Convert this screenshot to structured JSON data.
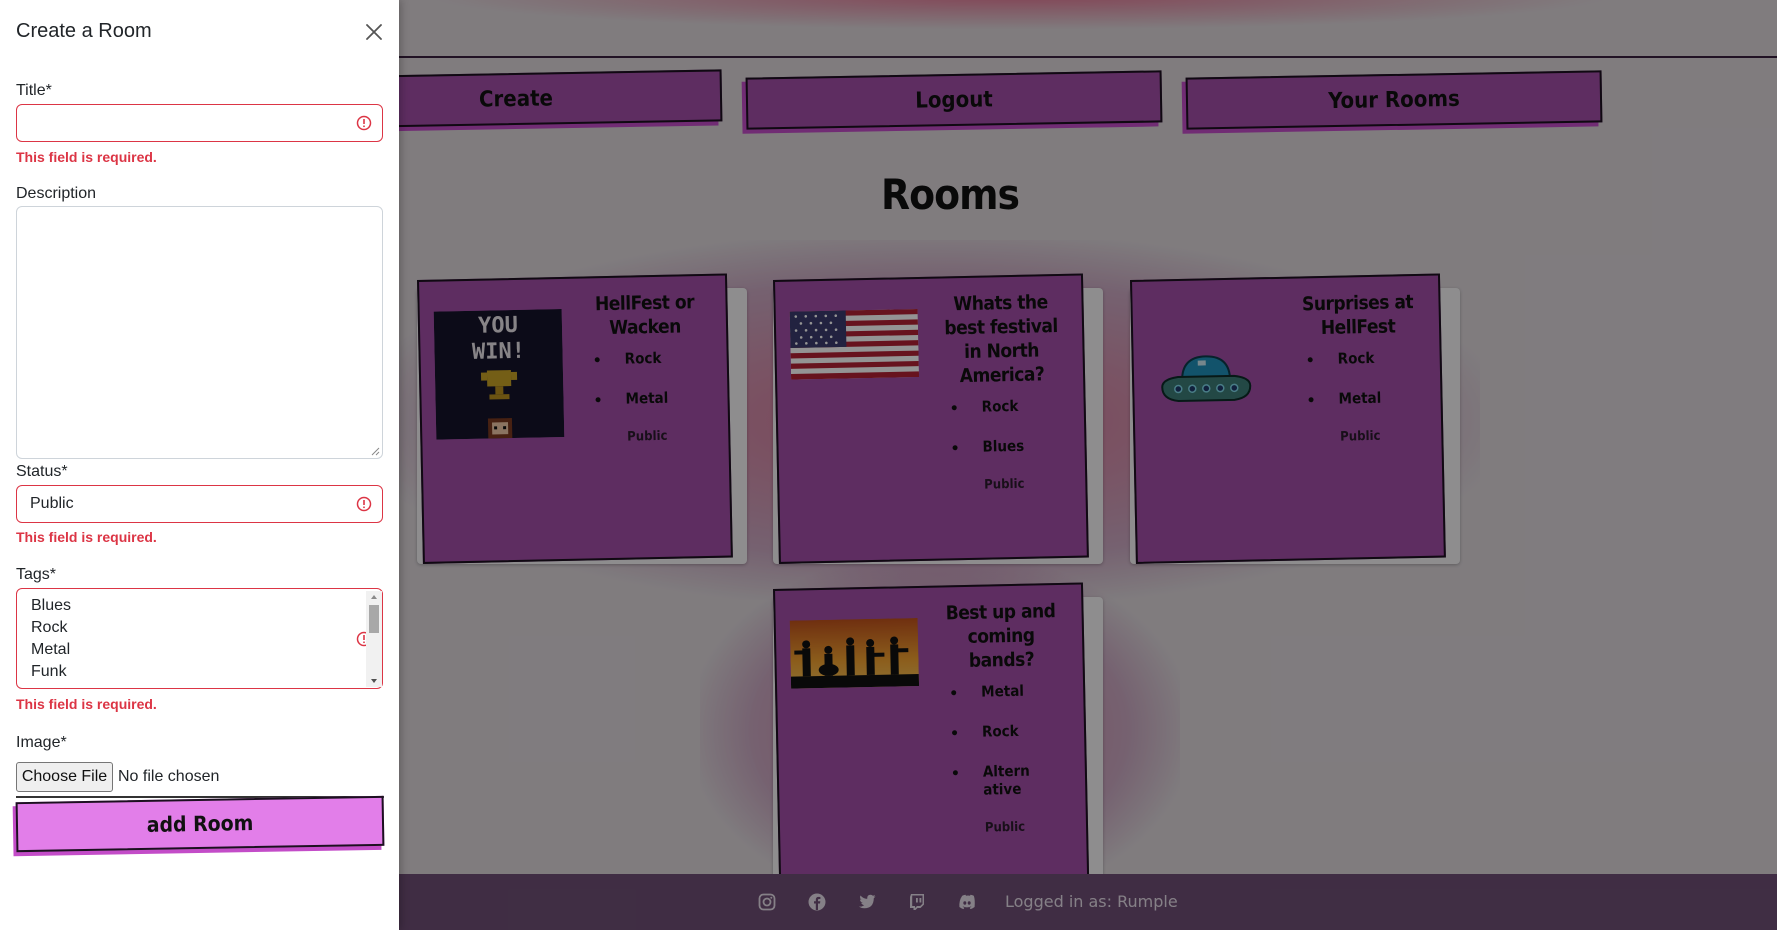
{
  "nav": {
    "create_label": "Create",
    "logout_label": "Logout",
    "your_rooms_label": "Your Rooms"
  },
  "page": {
    "heading": "Rooms"
  },
  "rooms": [
    {
      "title": "HellFest or Wacken",
      "image": "you-win-trophy-pixel-art",
      "tags": [
        "Rock",
        "Metal"
      ],
      "status": "Public"
    },
    {
      "title": "Whats the best festival in North America?",
      "image": "us-flag",
      "tags": [
        "Rock",
        "Blues"
      ],
      "status": "Public"
    },
    {
      "title": "Surprises at HellFest",
      "image": "ufo-pixel-art",
      "tags": [
        "Rock",
        "Metal"
      ],
      "status": "Public"
    },
    {
      "title": "Best up and coming bands?",
      "image": "band-silhouette-sunset",
      "tags": [
        "Metal",
        "Rock",
        "Alternative"
      ],
      "status": "Public"
    }
  ],
  "footer": {
    "icons": [
      "instagram-icon",
      "facebook-icon",
      "twitter-icon",
      "twitch-icon",
      "discord-icon"
    ],
    "logged_in_text": "Logged in as: Rumple"
  },
  "form": {
    "title": "Create a Room",
    "title_label": "Title*",
    "title_value": "",
    "title_error": "This field is required.",
    "description_label": "Description",
    "description_value": "",
    "status_label": "Status*",
    "status_value": "Public",
    "status_error": "This field is required.",
    "tags_label": "Tags*",
    "tags_options": [
      "Blues",
      "Rock",
      "Metal",
      "Funk"
    ],
    "tags_error": "This field is required.",
    "image_label": "Image*",
    "choose_file_label": "Choose File",
    "no_file_text": "No file chosen",
    "submit_label": "add Room"
  },
  "colors": {
    "card_purple": "#a24fa8",
    "button_pink": "#e27ee9",
    "error_red": "#dc3545",
    "footer_purple": "#6f4f75"
  }
}
